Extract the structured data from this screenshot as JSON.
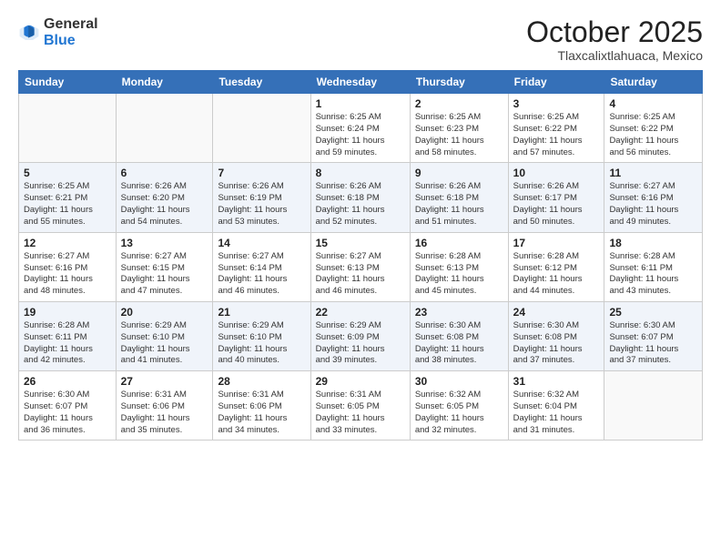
{
  "logo": {
    "general": "General",
    "blue": "Blue"
  },
  "header": {
    "month": "October 2025",
    "location": "Tlaxcalixtlahuaca, Mexico"
  },
  "weekdays": [
    "Sunday",
    "Monday",
    "Tuesday",
    "Wednesday",
    "Thursday",
    "Friday",
    "Saturday"
  ],
  "weeks": [
    [
      {
        "day": "",
        "info": ""
      },
      {
        "day": "",
        "info": ""
      },
      {
        "day": "",
        "info": ""
      },
      {
        "day": "1",
        "info": "Sunrise: 6:25 AM\nSunset: 6:24 PM\nDaylight: 11 hours\nand 59 minutes."
      },
      {
        "day": "2",
        "info": "Sunrise: 6:25 AM\nSunset: 6:23 PM\nDaylight: 11 hours\nand 58 minutes."
      },
      {
        "day": "3",
        "info": "Sunrise: 6:25 AM\nSunset: 6:22 PM\nDaylight: 11 hours\nand 57 minutes."
      },
      {
        "day": "4",
        "info": "Sunrise: 6:25 AM\nSunset: 6:22 PM\nDaylight: 11 hours\nand 56 minutes."
      }
    ],
    [
      {
        "day": "5",
        "info": "Sunrise: 6:25 AM\nSunset: 6:21 PM\nDaylight: 11 hours\nand 55 minutes."
      },
      {
        "day": "6",
        "info": "Sunrise: 6:26 AM\nSunset: 6:20 PM\nDaylight: 11 hours\nand 54 minutes."
      },
      {
        "day": "7",
        "info": "Sunrise: 6:26 AM\nSunset: 6:19 PM\nDaylight: 11 hours\nand 53 minutes."
      },
      {
        "day": "8",
        "info": "Sunrise: 6:26 AM\nSunset: 6:18 PM\nDaylight: 11 hours\nand 52 minutes."
      },
      {
        "day": "9",
        "info": "Sunrise: 6:26 AM\nSunset: 6:18 PM\nDaylight: 11 hours\nand 51 minutes."
      },
      {
        "day": "10",
        "info": "Sunrise: 6:26 AM\nSunset: 6:17 PM\nDaylight: 11 hours\nand 50 minutes."
      },
      {
        "day": "11",
        "info": "Sunrise: 6:27 AM\nSunset: 6:16 PM\nDaylight: 11 hours\nand 49 minutes."
      }
    ],
    [
      {
        "day": "12",
        "info": "Sunrise: 6:27 AM\nSunset: 6:16 PM\nDaylight: 11 hours\nand 48 minutes."
      },
      {
        "day": "13",
        "info": "Sunrise: 6:27 AM\nSunset: 6:15 PM\nDaylight: 11 hours\nand 47 minutes."
      },
      {
        "day": "14",
        "info": "Sunrise: 6:27 AM\nSunset: 6:14 PM\nDaylight: 11 hours\nand 46 minutes."
      },
      {
        "day": "15",
        "info": "Sunrise: 6:27 AM\nSunset: 6:13 PM\nDaylight: 11 hours\nand 46 minutes."
      },
      {
        "day": "16",
        "info": "Sunrise: 6:28 AM\nSunset: 6:13 PM\nDaylight: 11 hours\nand 45 minutes."
      },
      {
        "day": "17",
        "info": "Sunrise: 6:28 AM\nSunset: 6:12 PM\nDaylight: 11 hours\nand 44 minutes."
      },
      {
        "day": "18",
        "info": "Sunrise: 6:28 AM\nSunset: 6:11 PM\nDaylight: 11 hours\nand 43 minutes."
      }
    ],
    [
      {
        "day": "19",
        "info": "Sunrise: 6:28 AM\nSunset: 6:11 PM\nDaylight: 11 hours\nand 42 minutes."
      },
      {
        "day": "20",
        "info": "Sunrise: 6:29 AM\nSunset: 6:10 PM\nDaylight: 11 hours\nand 41 minutes."
      },
      {
        "day": "21",
        "info": "Sunrise: 6:29 AM\nSunset: 6:10 PM\nDaylight: 11 hours\nand 40 minutes."
      },
      {
        "day": "22",
        "info": "Sunrise: 6:29 AM\nSunset: 6:09 PM\nDaylight: 11 hours\nand 39 minutes."
      },
      {
        "day": "23",
        "info": "Sunrise: 6:30 AM\nSunset: 6:08 PM\nDaylight: 11 hours\nand 38 minutes."
      },
      {
        "day": "24",
        "info": "Sunrise: 6:30 AM\nSunset: 6:08 PM\nDaylight: 11 hours\nand 37 minutes."
      },
      {
        "day": "25",
        "info": "Sunrise: 6:30 AM\nSunset: 6:07 PM\nDaylight: 11 hours\nand 37 minutes."
      }
    ],
    [
      {
        "day": "26",
        "info": "Sunrise: 6:30 AM\nSunset: 6:07 PM\nDaylight: 11 hours\nand 36 minutes."
      },
      {
        "day": "27",
        "info": "Sunrise: 6:31 AM\nSunset: 6:06 PM\nDaylight: 11 hours\nand 35 minutes."
      },
      {
        "day": "28",
        "info": "Sunrise: 6:31 AM\nSunset: 6:06 PM\nDaylight: 11 hours\nand 34 minutes."
      },
      {
        "day": "29",
        "info": "Sunrise: 6:31 AM\nSunset: 6:05 PM\nDaylight: 11 hours\nand 33 minutes."
      },
      {
        "day": "30",
        "info": "Sunrise: 6:32 AM\nSunset: 6:05 PM\nDaylight: 11 hours\nand 32 minutes."
      },
      {
        "day": "31",
        "info": "Sunrise: 6:32 AM\nSunset: 6:04 PM\nDaylight: 11 hours\nand 31 minutes."
      },
      {
        "day": "",
        "info": ""
      }
    ]
  ]
}
